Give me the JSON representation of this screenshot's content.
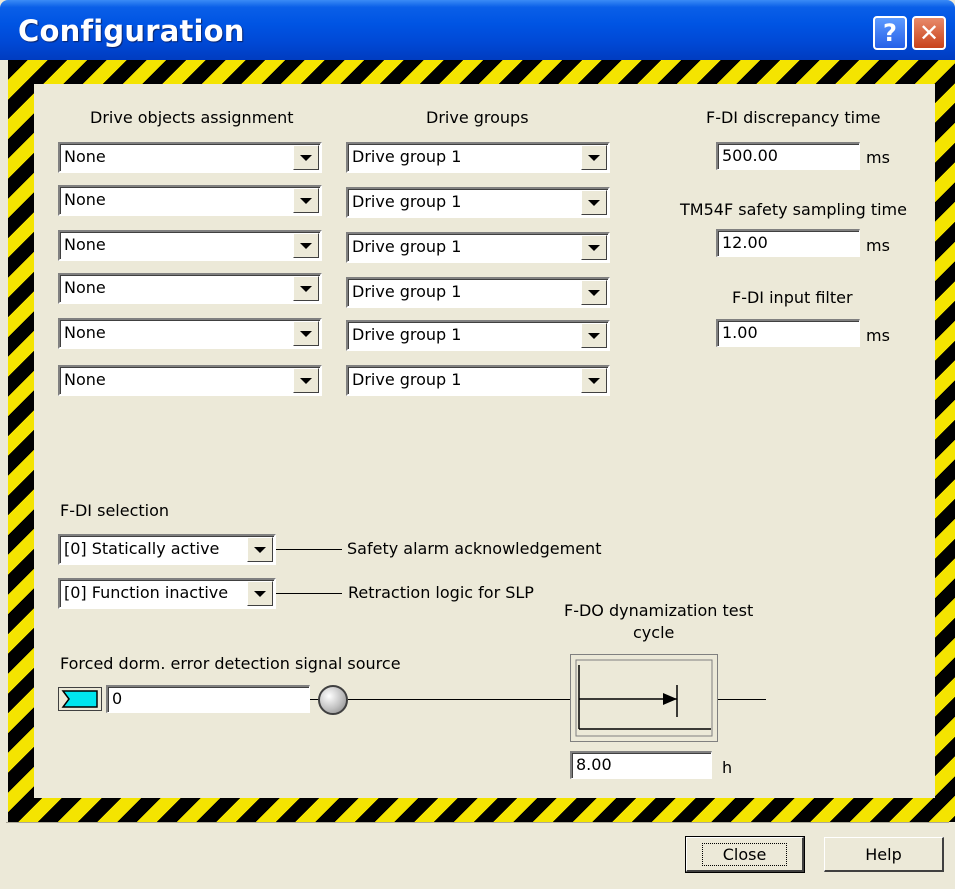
{
  "window": {
    "title": "Configuration",
    "help_glyph": "?",
    "close_glyph": "✕"
  },
  "drive_objects": {
    "header": "Drive objects assignment",
    "rows": [
      "None",
      "None",
      "None",
      "None",
      "None",
      "None"
    ]
  },
  "drive_groups": {
    "header": "Drive groups",
    "rows": [
      "Drive group 1",
      "Drive group 1",
      "Drive group 1",
      "Drive group 1",
      "Drive group 1",
      "Drive group 1"
    ]
  },
  "timing": {
    "discrepancy": {
      "label": "F-DI discrepancy time",
      "value": "500.00",
      "unit": "ms"
    },
    "sampling": {
      "label": "TM54F safety sampling time",
      "value": "12.00",
      "unit": "ms"
    },
    "filter": {
      "label": "F-DI input filter",
      "value": "1.00",
      "unit": "ms"
    }
  },
  "fdi_selection": {
    "label": "F-DI selection",
    "ack": {
      "value": "[0] Statically active",
      "label": "Safety alarm acknowledgement"
    },
    "retraction": {
      "value": "[0] Function inactive",
      "label": "Retraction logic for SLP"
    }
  },
  "forced_dormant": {
    "label": "Forced dorm. error detection signal source",
    "value": "0"
  },
  "fdo_test": {
    "label_line1": "F-DO dynamization test",
    "label_line2": "cycle",
    "value": "8.00",
    "unit": "h"
  },
  "buttons": {
    "close": "Close",
    "help": "Help"
  },
  "colors": {
    "hazard_yellow": "#f4e400",
    "hazard_black": "#000000",
    "titlebar_blue": "#0054e3",
    "connector_cyan": "#00ffff"
  }
}
